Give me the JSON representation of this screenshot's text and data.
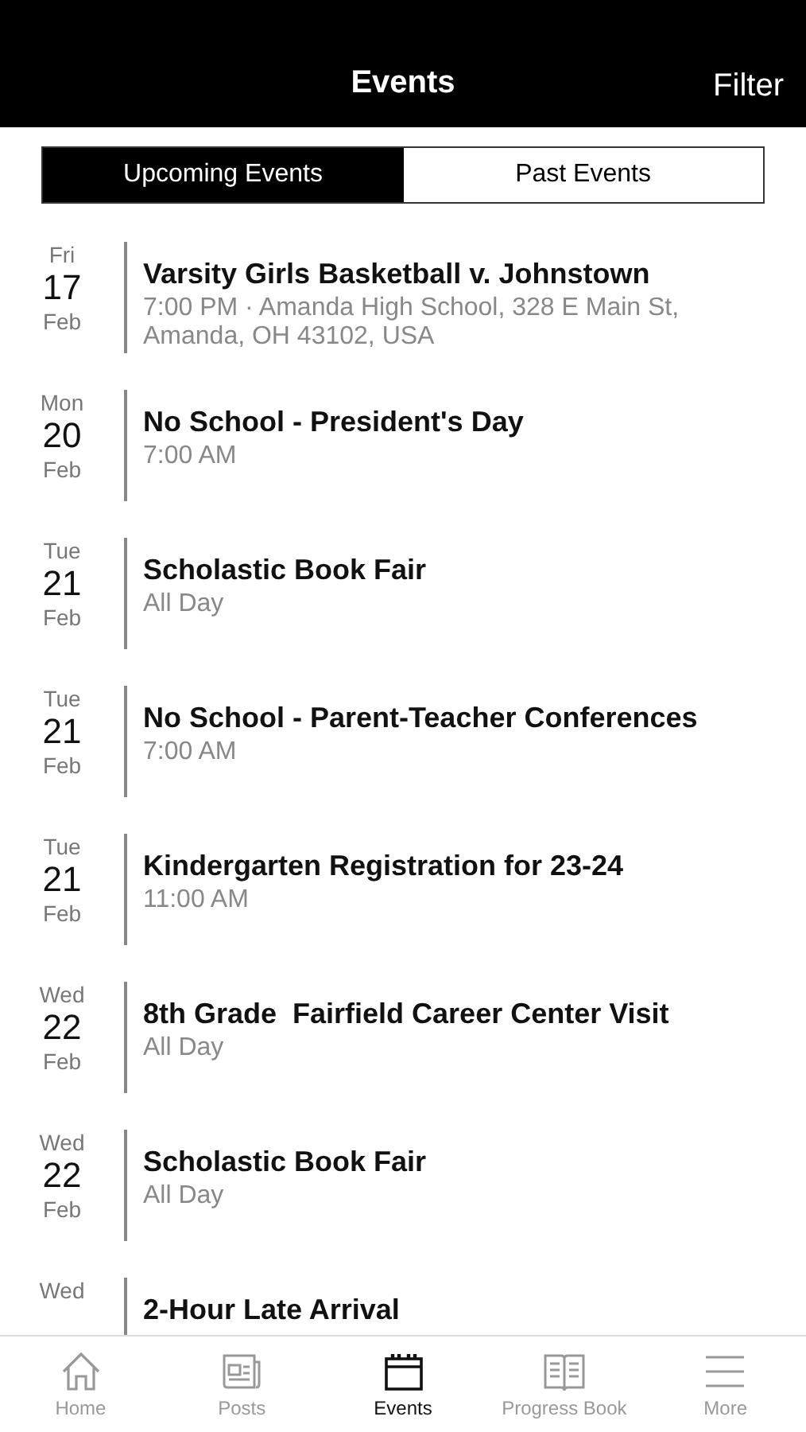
{
  "header": {
    "title": "Events",
    "filter": "Filter"
  },
  "segments": [
    {
      "label": "Upcoming Events",
      "selected": true
    },
    {
      "label": "Past Events",
      "selected": false
    }
  ],
  "events": [
    {
      "weekday": "Fri",
      "day": "17",
      "month": "Feb",
      "title": "Varsity Girls Basketball v. Johnstown",
      "detail": "7:00 PM · Amanda High School, 328 E Main St, Amanda, OH 43102, USA"
    },
    {
      "weekday": "Mon",
      "day": "20",
      "month": "Feb",
      "title": "No School - President's Day",
      "detail": "7:00 AM"
    },
    {
      "weekday": "Tue",
      "day": "21",
      "month": "Feb",
      "title": "Scholastic Book Fair",
      "detail": "All Day"
    },
    {
      "weekday": "Tue",
      "day": "21",
      "month": "Feb",
      "title": "No School - Parent-Teacher Conferences",
      "detail": "7:00 AM"
    },
    {
      "weekday": "Tue",
      "day": "21",
      "month": "Feb",
      "title": "Kindergarten Registration for 23-24",
      "detail": "11:00 AM"
    },
    {
      "weekday": "Wed",
      "day": "22",
      "month": "Feb",
      "title": "8th Grade  Fairfield Career Center Visit",
      "detail": "All Day"
    },
    {
      "weekday": "Wed",
      "day": "22",
      "month": "Feb",
      "title": "Scholastic Book Fair",
      "detail": "All Day"
    },
    {
      "weekday": "Wed",
      "title": "2-Hour Late Arrival"
    }
  ],
  "tab_bar": [
    {
      "kind": "home",
      "label": "Home",
      "selected": false
    },
    {
      "kind": "posts",
      "label": "Posts",
      "selected": false
    },
    {
      "kind": "events",
      "label": "Events",
      "selected": true
    },
    {
      "kind": "book",
      "label": "Progress Book",
      "selected": false
    },
    {
      "kind": "more",
      "label": "More",
      "selected": false
    }
  ]
}
